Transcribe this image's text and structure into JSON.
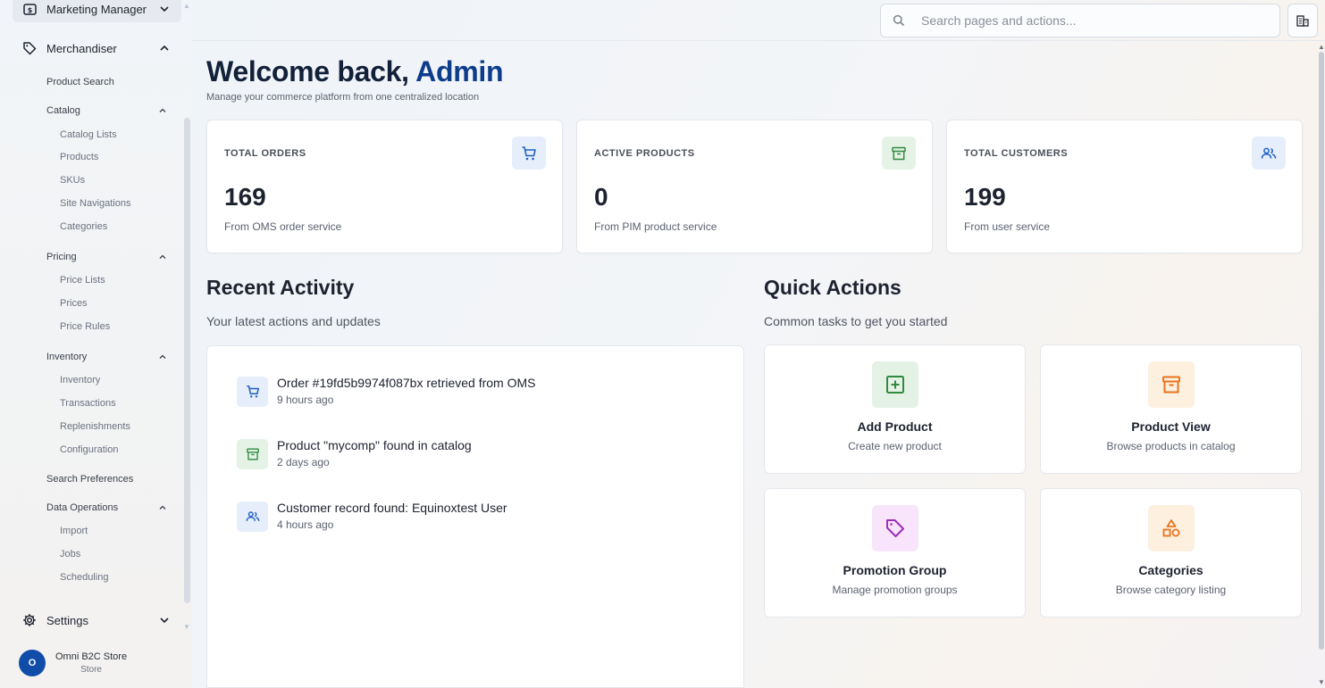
{
  "sidebar": {
    "marketing_manager": "Marketing Manager",
    "merchandiser": "Merchandiser",
    "product_search": "Product Search",
    "catalog": {
      "label": "Catalog",
      "items": [
        "Catalog Lists",
        "Products",
        "SKUs",
        "Site Navigations",
        "Categories"
      ]
    },
    "pricing": {
      "label": "Pricing",
      "items": [
        "Price Lists",
        "Prices",
        "Price Rules"
      ]
    },
    "inventory": {
      "label": "Inventory",
      "items": [
        "Inventory",
        "Transactions",
        "Replenishments",
        "Configuration"
      ]
    },
    "search_preferences": "Search Preferences",
    "data_operations": {
      "label": "Data Operations",
      "items": [
        "Import",
        "Jobs",
        "Scheduling"
      ]
    },
    "settings": "Settings",
    "store": {
      "avatar_letter": "O",
      "name": "Omni B2C Store",
      "role": "Store",
      "avatar_color": "#0f4da8"
    }
  },
  "header": {
    "search_placeholder": "Search pages and actions..."
  },
  "welcome": {
    "prefix": "Welcome back, ",
    "name": "Admin",
    "subtitle": "Manage your commerce platform from one centralized location"
  },
  "stats": [
    {
      "label": "TOTAL ORDERS",
      "value": "169",
      "note": "From OMS order service",
      "icon": "cart-icon",
      "color": "#1d5fc4",
      "bg": "#e6eefb"
    },
    {
      "label": "ACTIVE PRODUCTS",
      "value": "0",
      "note": "From PIM product service",
      "icon": "archive-icon",
      "color": "#2f8a3e",
      "bg": "#e5f3e7"
    },
    {
      "label": "TOTAL CUSTOMERS",
      "value": "199",
      "note": "From user service",
      "icon": "users-icon",
      "color": "#1d5fc4",
      "bg": "#e6eefb"
    }
  ],
  "recent_activity": {
    "title": "Recent Activity",
    "subtitle": "Your latest actions and updates",
    "items": [
      {
        "title": "Order #19fd5b9974f087bx retrieved from OMS",
        "time": "9 hours ago",
        "icon": "cart-icon"
      },
      {
        "title": "Product \"mycomp\" found in catalog",
        "time": "2 days ago",
        "icon": "archive-icon"
      },
      {
        "title": "Customer record found: Equinoxtest User",
        "time": "4 hours ago",
        "icon": "users-icon"
      }
    ]
  },
  "quick_actions": {
    "title": "Quick Actions",
    "subtitle": "Common tasks to get you started",
    "items": [
      {
        "title": "Add Product",
        "desc": "Create new product",
        "icon": "plus-square-icon",
        "color": "#2f8a3e",
        "bg": "#e3f2e5"
      },
      {
        "title": "Product View",
        "desc": "Browse products in catalog",
        "icon": "archive-icon",
        "color": "#e8731c",
        "bg": "#fdf0df"
      },
      {
        "title": "Promotion Group",
        "desc": "Manage promotion groups",
        "icon": "tag-icon",
        "color": "#9b2fb8",
        "bg": "#f8e4fb"
      },
      {
        "title": "Categories",
        "desc": "Browse category listing",
        "icon": "shapes-icon",
        "color": "#e8731c",
        "bg": "#fdf0df"
      }
    ]
  }
}
